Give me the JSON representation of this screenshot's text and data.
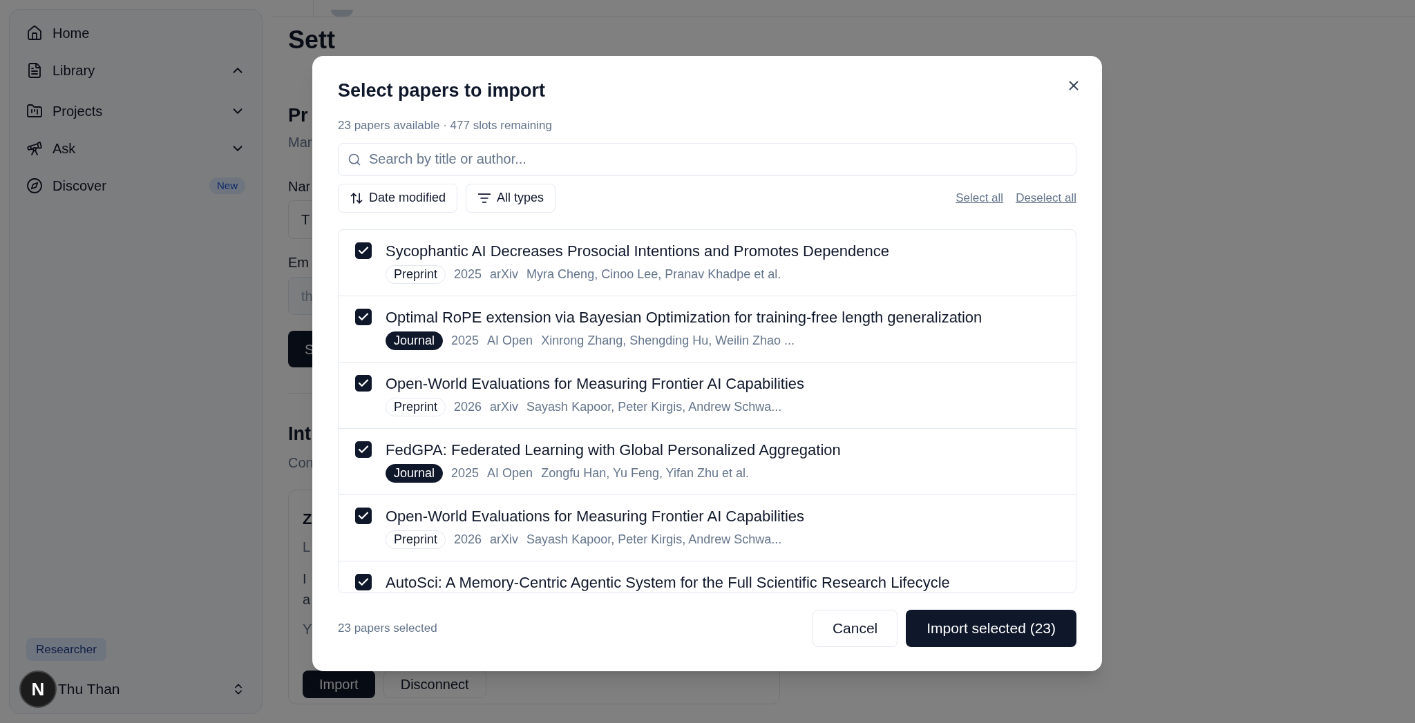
{
  "sidebar": {
    "items": [
      {
        "label": "Home"
      },
      {
        "label": "Library",
        "expanded": true
      },
      {
        "label": "Projects",
        "expanded": false
      },
      {
        "label": "Ask",
        "expanded": false
      },
      {
        "label": "Discover",
        "badge": "New"
      }
    ],
    "role_badge": "Researcher",
    "user": {
      "initial": "N",
      "name": "Thu Than"
    }
  },
  "background": {
    "heading": "Sett",
    "section_1": {
      "title": "Pr",
      "subtitle": "Mar",
      "field_1_label": "Nar",
      "field_1_value": "T",
      "field_2_label": "Em",
      "field_2_placeholder": "th",
      "button": "S"
    },
    "section_2": {
      "title": "Int",
      "subtitle": "Con",
      "card": {
        "title": "Z",
        "subtitle": "L",
        "text_1": "I",
        "text_2": "a",
        "text_3": "Y",
        "buttons": [
          "Import",
          "Disconnect"
        ]
      }
    }
  },
  "dialog": {
    "title": "Select papers to import",
    "subtitle": "23 papers available · 477 slots remaining",
    "search": {
      "placeholder": "Search by title or author..."
    },
    "sort_button": "Date modified",
    "filter_button": "All types",
    "select_all": "Select all",
    "deselect_all": "Deselect all",
    "papers": [
      {
        "title": "Sycophantic AI Decreases Prosocial Intentions and Promotes Dependence",
        "badge": {
          "label": "Preprint",
          "filled": false
        },
        "year": "2025",
        "venue": "arXiv",
        "authors": "Myra Cheng, Cinoo Lee, Pranav Khadpe et al.",
        "checked": true
      },
      {
        "title": "Optimal RoPE extension via Bayesian Optimization for training-free length generalization",
        "badge": {
          "label": "Journal",
          "filled": true
        },
        "year": "2025",
        "venue": "AI Open",
        "authors": "Xinrong Zhang, Shengding Hu, Weilin Zhao ...",
        "checked": true
      },
      {
        "title": "Open-World Evaluations for Measuring Frontier AI Capabilities",
        "badge": {
          "label": "Preprint",
          "filled": false
        },
        "year": "2026",
        "venue": "arXiv",
        "authors": "Sayash Kapoor, Peter Kirgis, Andrew Schwa...",
        "checked": true
      },
      {
        "title": "FedGPA: Federated Learning with Global Personalized Aggregation",
        "badge": {
          "label": "Journal",
          "filled": true
        },
        "year": "2025",
        "venue": "AI Open",
        "authors": "Zongfu Han, Yu Feng, Yifan Zhu et al.",
        "checked": true
      },
      {
        "title": "Open-World Evaluations for Measuring Frontier AI Capabilities",
        "badge": {
          "label": "Preprint",
          "filled": false
        },
        "year": "2026",
        "venue": "arXiv",
        "authors": "Sayash Kapoor, Peter Kirgis, Andrew Schwa...",
        "checked": true
      },
      {
        "title": "AutoSci: A Memory-Centric Agentic System for the Full Scientific Research Lifecycle",
        "checked": true
      }
    ],
    "footer_status": "23 papers selected",
    "cancel_button": "Cancel",
    "import_button": "Import selected (23)"
  }
}
